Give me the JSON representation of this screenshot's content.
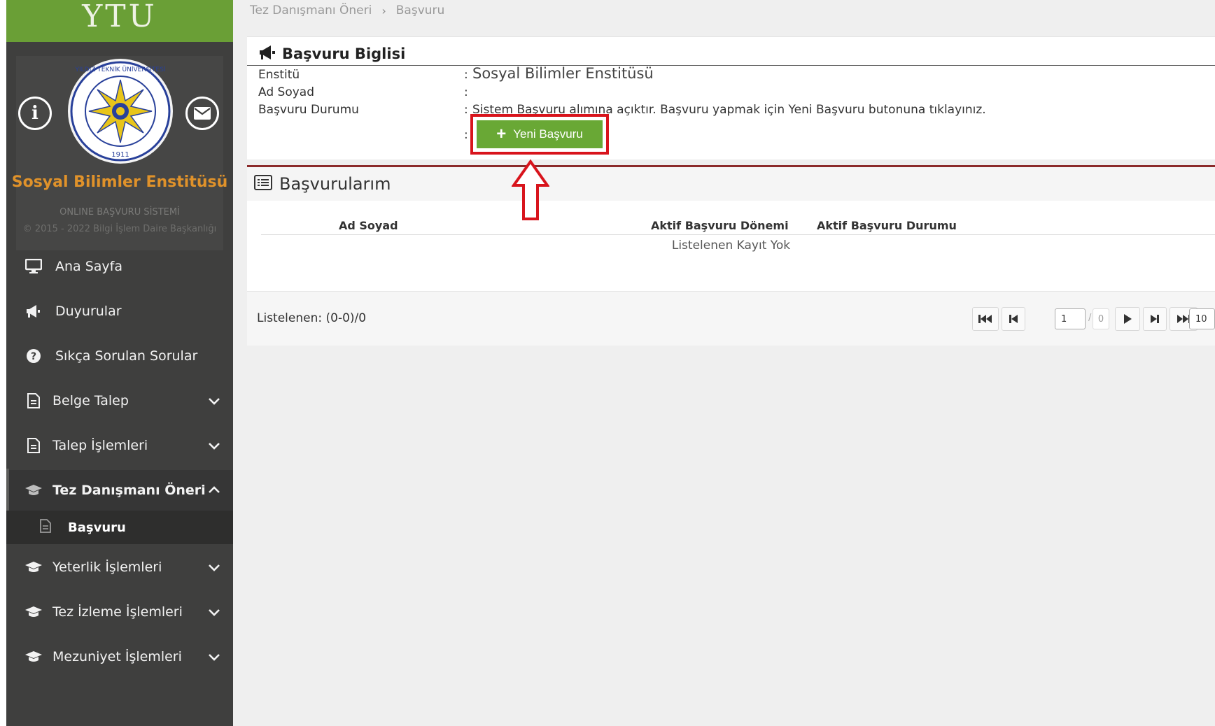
{
  "brand": {
    "logo_text": "YTU"
  },
  "profile": {
    "institute_title": "Sosyal Bilimler Enstitüsü",
    "system_title": "ONLINE BAŞVURU SİSTEMİ",
    "copyright": "© 2015 - 2022 Bilgi İşlem Daire Başkanlığı",
    "seal_text_top": "YILDIZ TEKNİK ÜNİVERSİTESİ",
    "seal_year": "1911"
  },
  "sidebar": {
    "items": [
      {
        "label": "Ana Sayfa",
        "icon": "monitor-icon"
      },
      {
        "label": "Duyurular",
        "icon": "megaphone-icon"
      },
      {
        "label": "Sıkça Sorulan Sorular",
        "icon": "question-icon"
      },
      {
        "label": "Belge Talep",
        "icon": "document-icon"
      },
      {
        "label": "Talep İşlemleri",
        "icon": "document-icon"
      },
      {
        "label": "Tez Danışmanı Öneri",
        "icon": "graduation-cap-icon"
      },
      {
        "label": "Yeterlik İşlemleri",
        "icon": "graduation-cap-icon"
      },
      {
        "label": "Tez İzleme İşlemleri",
        "icon": "graduation-cap-icon"
      },
      {
        "label": "Mezuniyet İşlemleri",
        "icon": "graduation-cap-icon"
      }
    ],
    "sub_item": {
      "label": "Başvuru",
      "icon": "document-icon"
    }
  },
  "breadcrumb": {
    "parent": "Tez Danışmanı Öneri",
    "current": "Başvuru"
  },
  "info_panel": {
    "title": "Başvuru Biglisi",
    "rows": [
      {
        "label": "Enstitü",
        "value": "Sosyal Bilimler Enstitüsü"
      },
      {
        "label": "Ad Soyad",
        "value": ""
      },
      {
        "label": "Başvuru Durumu",
        "value": "Sistem Başvuru alımına açıktır. Başvuru yapmak için Yeni Başvuru butonuna tıklayınız."
      }
    ],
    "colon": ":",
    "new_button_label": "Yeni Başvuru"
  },
  "list_panel": {
    "title": "Başvurularım",
    "columns": [
      "Ad Soyad",
      "Aktif Başvuru Dönemi",
      "Aktif Başvuru Durumu"
    ],
    "empty_message": "Listelenen Kayıt Yok",
    "listed_count": "Listelenen: (0-0)/0",
    "current_page": "1",
    "page_slash": "/",
    "total_pages": "0",
    "page_size": "10"
  },
  "colors": {
    "brand_green": "#6a9f36",
    "sidebar_bg": "#3f3f3e",
    "institute_orange": "#e0922a",
    "button_green": "#69a835",
    "highlight_red": "#d8141c"
  }
}
